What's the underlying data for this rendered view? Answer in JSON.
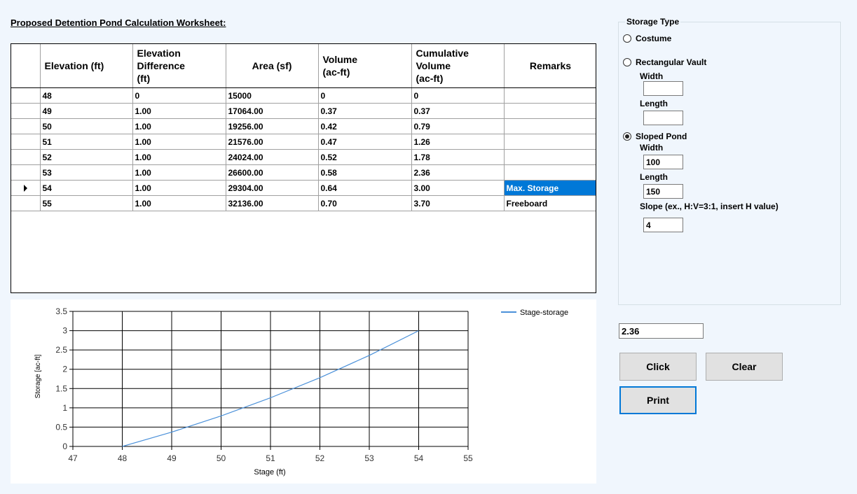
{
  "page_title": "Proposed Detention Pond Calculation Worksheet:",
  "grid": {
    "headers": {
      "elevation": "Elevation (ft)",
      "elev_diff": [
        "Elevation",
        "Difference",
        "(ft)"
      ],
      "area": "Area (sf)",
      "volume": [
        "Volume",
        "(ac-ft)"
      ],
      "cumulative": [
        "Cumulative",
        "Volume",
        "(ac-ft)"
      ],
      "remarks": "Remarks"
    },
    "rows": [
      {
        "elevation": "48",
        "diff": "0",
        "area": "15000",
        "volume": "0",
        "cumulative": "0",
        "remarks": ""
      },
      {
        "elevation": "49",
        "diff": "1.00",
        "area": "17064.00",
        "volume": "0.37",
        "cumulative": "0.37",
        "remarks": ""
      },
      {
        "elevation": "50",
        "diff": "1.00",
        "area": "19256.00",
        "volume": "0.42",
        "cumulative": "0.79",
        "remarks": ""
      },
      {
        "elevation": "51",
        "diff": "1.00",
        "area": "21576.00",
        "volume": "0.47",
        "cumulative": "1.26",
        "remarks": ""
      },
      {
        "elevation": "52",
        "diff": "1.00",
        "area": "24024.00",
        "volume": "0.52",
        "cumulative": "1.78",
        "remarks": ""
      },
      {
        "elevation": "53",
        "diff": "1.00",
        "area": "26600.00",
        "volume": "0.58",
        "cumulative": "2.36",
        "remarks": ""
      },
      {
        "elevation": "54",
        "diff": "1.00",
        "area": "29304.00",
        "volume": "0.64",
        "cumulative": "3.00",
        "remarks": "Max. Storage"
      },
      {
        "elevation": "55",
        "diff": "1.00",
        "area": "32136.00",
        "volume": "0.70",
        "cumulative": "3.70",
        "remarks": "Freeboard"
      }
    ],
    "current_row": 6
  },
  "chart_data": {
    "type": "line",
    "xlabel": "Stage (ft)",
    "ylabel": "Storage [ac-ft]",
    "xlim": [
      47,
      55
    ],
    "ylim": [
      0,
      3.5
    ],
    "x_ticks": [
      "47",
      "48",
      "49",
      "50",
      "51",
      "52",
      "53",
      "54",
      "55"
    ],
    "y_ticks": [
      "0",
      "0.5",
      "1",
      "1.5",
      "2",
      "2.5",
      "3",
      "3.5"
    ],
    "grid": true,
    "legend_position": "top-right",
    "series": [
      {
        "name": "Stage-storage",
        "color": "#4a90d9",
        "x": [
          48,
          49,
          50,
          51,
          52,
          53,
          54
        ],
        "y": [
          0,
          0.37,
          0.79,
          1.26,
          1.78,
          2.36,
          3.0
        ]
      }
    ]
  },
  "storage": {
    "legend": "Storage Type",
    "costume_label": "Costume",
    "rect_label": "Rectangular Vault",
    "rect_width_label": "Width",
    "rect_length_label": "Length",
    "rect_width_value": "",
    "rect_length_value": "",
    "sloped_label": "Sloped Pond",
    "sloped_width_label": "Width",
    "sloped_width_value": "100",
    "sloped_length_label": "Length",
    "sloped_length_value": "150",
    "slope_label": "Slope (ex., H:V=3:1, insert H value)",
    "slope_value": "4",
    "selected": "sloped"
  },
  "result_value": "2.36",
  "buttons": {
    "click": "Click",
    "clear": "Clear",
    "print": "Print"
  }
}
